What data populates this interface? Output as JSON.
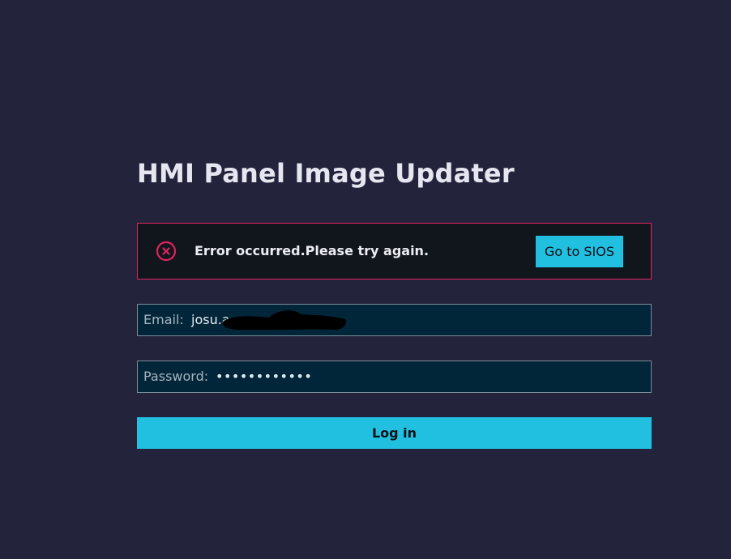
{
  "page": {
    "title": "HMI Panel Image Updater"
  },
  "error": {
    "message": "Error occurred.Please try again.",
    "action_label": "Go to SIOS",
    "icon": "error-circle-x-icon",
    "color": "#e0245e"
  },
  "form": {
    "email": {
      "label": "Email:",
      "value": "josu.a"
    },
    "password": {
      "label": "Password:",
      "value": "••••••••••••"
    },
    "submit_label": "Log in"
  },
  "colors": {
    "background": "#23233c",
    "accent": "#22c0e0",
    "field_background": "#022639",
    "error_border": "#e0245e"
  }
}
